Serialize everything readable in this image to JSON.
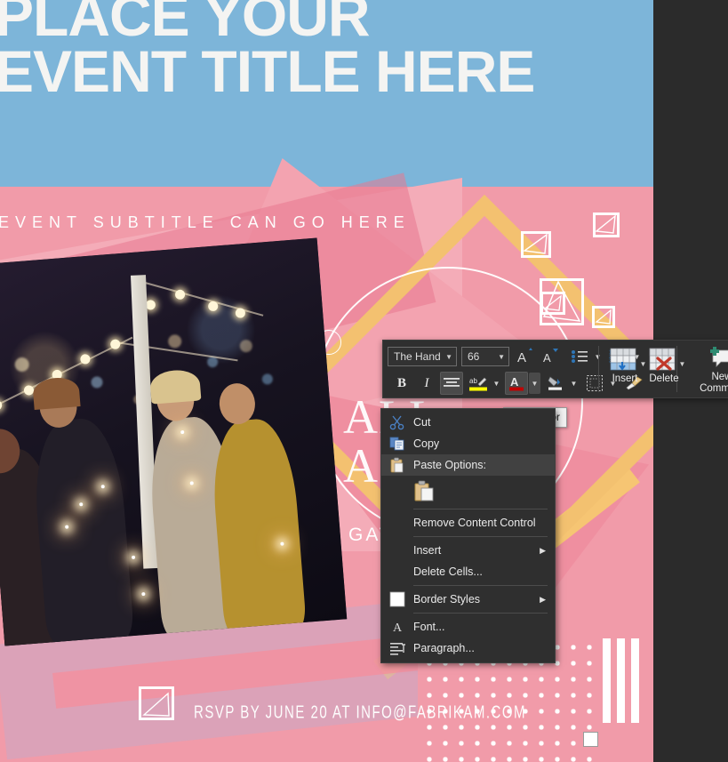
{
  "application": "word-mini-toolbar-context-menu",
  "document": {
    "headline": "PLACE YOUR EVENT TITLE HERE",
    "subtitle": "EVENT SUBTITLE CAN GO HERE",
    "mid_text": "ALL AGES W",
    "gather_text": "GAT",
    "rsvp": "RSVP BY JUNE 20 AT INFO@FABRIKAM.COM",
    "colors": {
      "blue": "#7bb3d8",
      "blue_dark": "#5e93b4",
      "pink": "#f19ba9",
      "pink_light": "#f4acb8",
      "pink_dark": "#e8798f",
      "gold": "#f3c170",
      "white": "#ffffff",
      "canvas_background": "#2b2b2b"
    }
  },
  "mini_toolbar": {
    "font_name": {
      "value": "The Hand",
      "arrow": "chevron-down"
    },
    "font_size": {
      "value": "66",
      "arrow": "chevron-down"
    },
    "grow_font": "A",
    "shrink_font": "A",
    "bullets": "bullets",
    "numbering": "numbering",
    "bold": "B",
    "italic": "I",
    "align_center": "align-center",
    "text_highlight": "text-highlight-color",
    "font_color": "font-color",
    "shading": "shading",
    "borders": "borders",
    "format_painter": "format-painter",
    "insert_label": "Insert",
    "delete_label": "Delete",
    "new_comment_label_1": "New",
    "new_comment_label_2": "Comment",
    "accent_font_color": "#c00000",
    "accent_highlight": "#ffff00"
  },
  "tooltip": {
    "text": "Font Color"
  },
  "context_menu": {
    "items": [
      {
        "label": "Cut",
        "accel": "t",
        "icon": "scissors-icon",
        "submenu": false,
        "selected": false
      },
      {
        "label": "Copy",
        "accel": "C",
        "icon": "copy-icon",
        "submenu": false,
        "selected": false
      },
      {
        "label": "Paste Options:",
        "accel": "",
        "icon": "paste-icon",
        "submenu": false,
        "selected": true
      },
      {
        "label": "Remove Content Control",
        "accel": "Re",
        "icon": "",
        "submenu": false,
        "selected": false
      },
      {
        "label": "Insert",
        "accel": "I",
        "icon": "",
        "submenu": true,
        "selected": false
      },
      {
        "label": "Delete Cells...",
        "accel": "D",
        "icon": "",
        "submenu": false,
        "selected": false
      },
      {
        "label": "Border Styles",
        "accel": "B",
        "icon": "border-swatch-icon",
        "submenu": true,
        "selected": false
      },
      {
        "label": "Font...",
        "accel": "F",
        "icon": "font-a-icon",
        "submenu": false,
        "selected": false
      },
      {
        "label": "Paragraph...",
        "accel": "P",
        "icon": "paragraph-icon",
        "submenu": false,
        "selected": false
      }
    ],
    "paste_button": "keep-source-formatting"
  }
}
